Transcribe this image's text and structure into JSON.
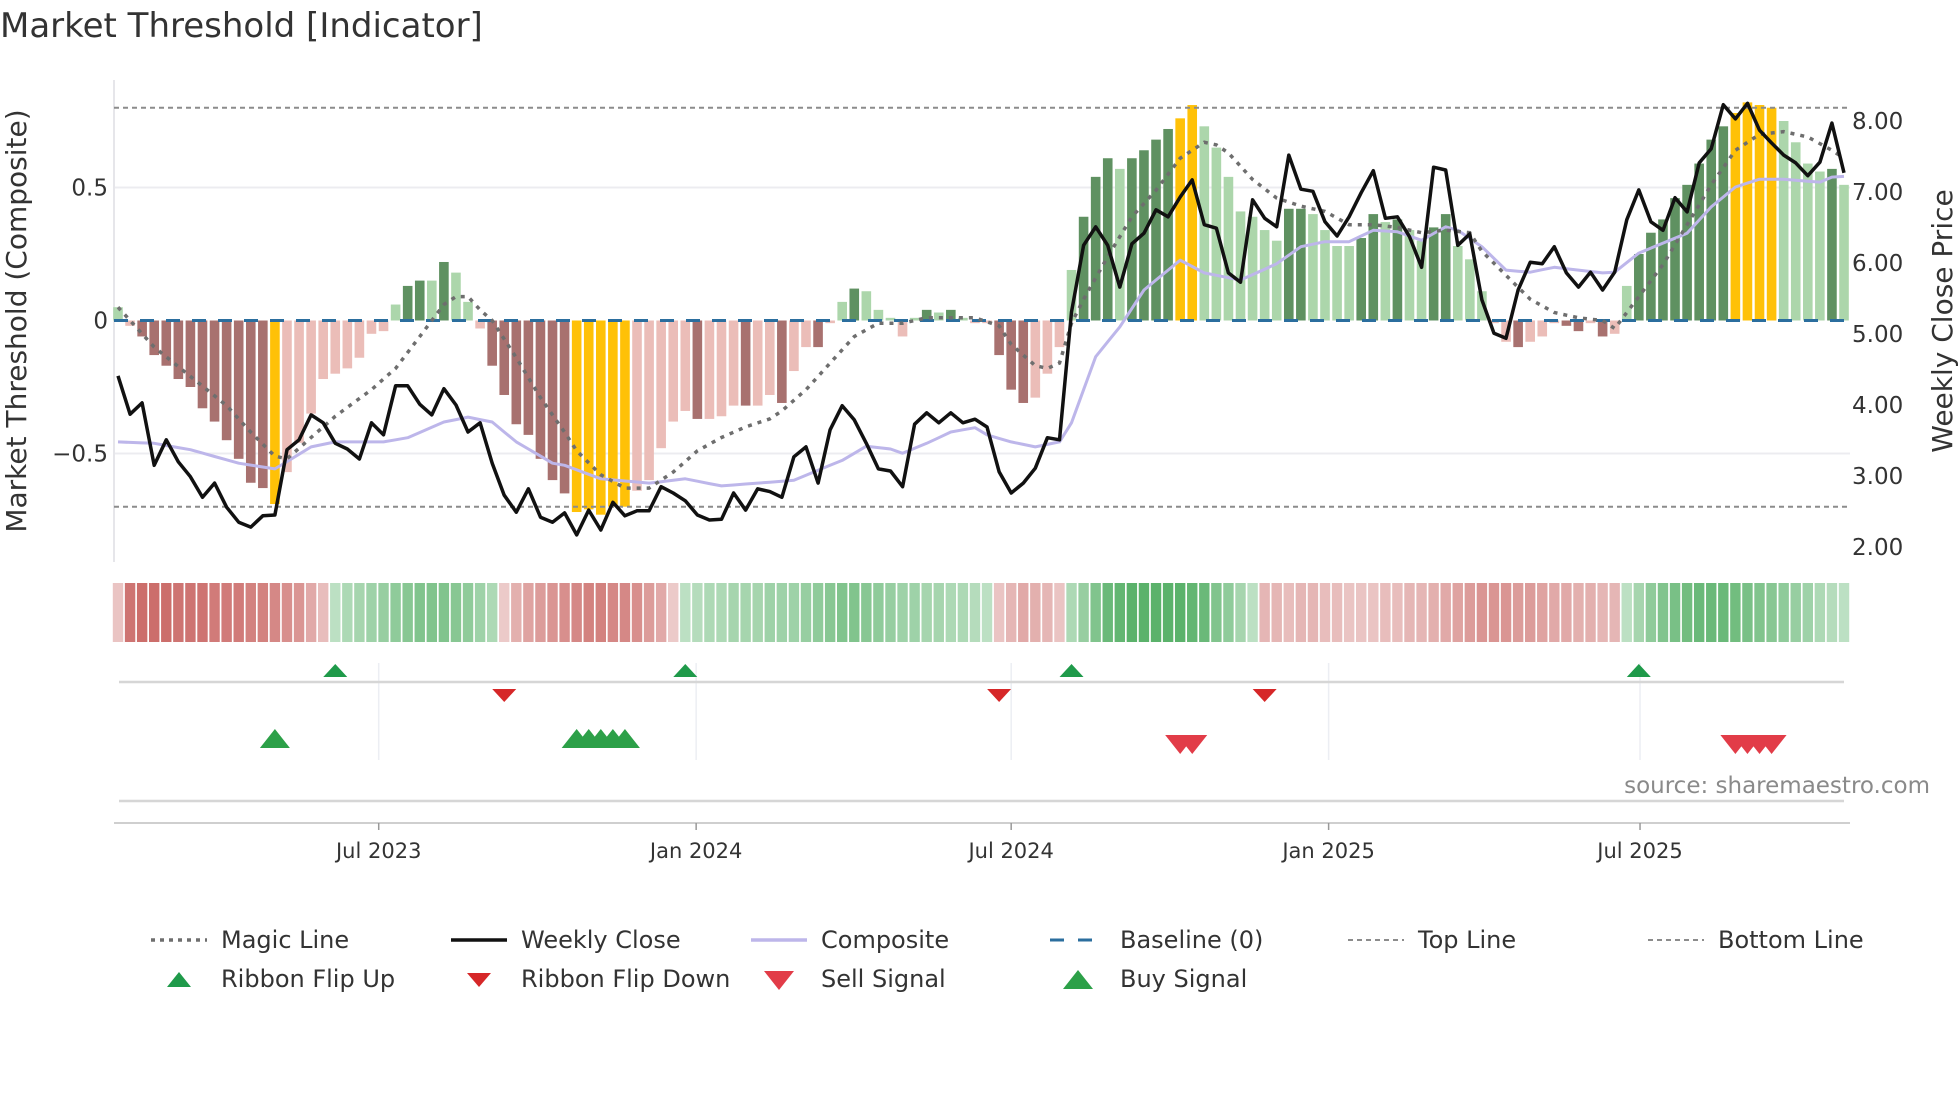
{
  "title": "Market Threshold [Indicator]",
  "source": "source: sharemaestro.com",
  "colors": {
    "dark_green": "#5f9161",
    "light_green": "#acd6ab",
    "dark_red": "#a8716f",
    "light_red": "#ebbdb8",
    "yellow": "#ffc107",
    "close": "#111111",
    "composite": "#bdb6ea",
    "magic": "#6e6e6e",
    "baseline": "#2b6e9e",
    "threshold": "#8c8c8c",
    "ribbon_red": "#c55a57",
    "ribbon_green": "#45a857",
    "flip_up": "#1f9a4a",
    "flip_down": "#d62728",
    "buy": "#2ca048",
    "sell": "#e23c48"
  },
  "legend": [
    {
      "key": "magic",
      "label": "Magic Line"
    },
    {
      "key": "close",
      "label": "Weekly Close"
    },
    {
      "key": "composite",
      "label": "Composite"
    },
    {
      "key": "baseline",
      "label": "Baseline (0)"
    },
    {
      "key": "top",
      "label": "Top Line"
    },
    {
      "key": "bottom",
      "label": "Bottom Line"
    },
    {
      "key": "flip_up",
      "label": "Ribbon Flip Up"
    },
    {
      "key": "flip_down",
      "label": "Ribbon Flip Down"
    },
    {
      "key": "sell",
      "label": "Sell Signal"
    },
    {
      "key": "buy",
      "label": "Buy Signal"
    }
  ],
  "chart_data": {
    "type": "bar+line",
    "title": "Market Threshold [Indicator]",
    "ylabel_left": "Market Threshold (Composite)",
    "ylabel_right": "Weekly Close Price",
    "x_unit": "week index (weekly, ~Feb 2023 to Oct 2025)",
    "x_ticks": [
      {
        "label": "Jul 2023",
        "week": 21.6
      },
      {
        "label": "Jan 2024",
        "week": 47.9
      },
      {
        "label": "Jul 2024",
        "week": 74.0
      },
      {
        "label": "Jan 2025",
        "week": 100.3
      },
      {
        "label": "Jul 2025",
        "week": 126.1
      }
    ],
    "left_axis": {
      "ylim": [
        -1.0,
        0.88
      ],
      "ticks": [
        {
          "v": 0.5,
          "label": "0.5"
        },
        {
          "v": 0,
          "label": "0"
        },
        {
          "v": -0.5,
          "label": "−0.5"
        }
      ]
    },
    "right_axis": {
      "ylim": [
        1.8,
        8.5
      ],
      "ticks": [
        {
          "v": 8,
          "label": "8.00"
        },
        {
          "v": 7,
          "label": "7.00"
        },
        {
          "v": 6,
          "label": "6.00"
        },
        {
          "v": 5,
          "label": "5.00"
        },
        {
          "v": 4,
          "label": "4.00"
        },
        {
          "v": 3,
          "label": "3.00"
        },
        {
          "v": 2,
          "label": "2.00"
        }
      ]
    },
    "top_line": 0.8,
    "bottom_line": -0.7,
    "baseline": 0,
    "histogram": [
      0.05,
      -0.02,
      -0.06,
      -0.13,
      -0.17,
      -0.22,
      -0.25,
      -0.33,
      -0.38,
      -0.45,
      -0.52,
      -0.61,
      -0.63,
      -0.69,
      -0.57,
      -0.46,
      -0.35,
      -0.22,
      -0.2,
      -0.18,
      -0.14,
      -0.05,
      -0.04,
      0.06,
      0.13,
      0.15,
      0.15,
      0.22,
      0.18,
      0.07,
      -0.03,
      -0.17,
      -0.28,
      -0.39,
      -0.43,
      -0.52,
      -0.6,
      -0.65,
      -0.72,
      -0.71,
      -0.73,
      -0.7,
      -0.7,
      -0.64,
      -0.6,
      -0.48,
      -0.38,
      -0.34,
      -0.37,
      -0.37,
      -0.36,
      -0.32,
      -0.32,
      -0.32,
      -0.28,
      -0.31,
      -0.19,
      -0.1,
      -0.1,
      -0.01,
      0.07,
      0.12,
      0.11,
      0.04,
      0.01,
      -0.06,
      0.01,
      0.04,
      0.03,
      0.04,
      0.01,
      -0.01,
      -0.01,
      -0.13,
      -0.26,
      -0.31,
      -0.29,
      -0.2,
      -0.1,
      0.19,
      0.39,
      0.54,
      0.61,
      0.57,
      0.61,
      0.64,
      0.68,
      0.72,
      0.76,
      0.81,
      0.73,
      0.65,
      0.54,
      0.41,
      0.39,
      0.34,
      0.3,
      0.42,
      0.42,
      0.4,
      0.34,
      0.28,
      0.28,
      0.31,
      0.4,
      0.37,
      0.38,
      0.34,
      0.3,
      0.35,
      0.4,
      0.28,
      0.23,
      0.11,
      -0.01,
      -0.08,
      -0.1,
      -0.08,
      -0.06,
      -0.01,
      -0.02,
      -0.04,
      -0.01,
      -0.06,
      -0.05,
      0.13,
      0.25,
      0.33,
      0.38,
      0.46,
      0.51,
      0.59,
      0.68,
      0.73,
      0.78,
      0.82,
      0.81,
      0.8,
      0.75,
      0.67,
      0.59,
      0.56,
      0.57,
      0.51
    ],
    "histogram_states": "grRRRRRRRRRRRYrrrrrrrrrgGGgGggrRRRRRRRYYYYYrrrrrRrrrRrrRrrRrgGgggrgGgGgrrRRRrrrgGGGgGGGGYYgggggggGGggggGGgGggGGgggrrRrrrRRrRrgGGGGGGGGYYYYggggGg",
    "histogram_state_legend": {
      "G": "strong up",
      "g": "weak up",
      "R": "strong down",
      "r": "weak down",
      "Y": "extreme"
    },
    "weekly_close": [
      4.41,
      3.87,
      4.03,
      3.15,
      3.51,
      3.2,
      2.99,
      2.7,
      2.9,
      2.56,
      2.35,
      2.28,
      2.44,
      2.45,
      3.37,
      3.51,
      3.86,
      3.75,
      3.46,
      3.38,
      3.24,
      3.75,
      3.58,
      4.27,
      4.27,
      4.01,
      3.86,
      4.23,
      4.0,
      3.62,
      3.75,
      3.18,
      2.73,
      2.49,
      2.82,
      2.42,
      2.35,
      2.48,
      2.17,
      2.52,
      2.24,
      2.63,
      2.44,
      2.51,
      2.51,
      2.85,
      2.76,
      2.65,
      2.45,
      2.38,
      2.39,
      2.76,
      2.52,
      2.82,
      2.78,
      2.7,
      3.27,
      3.41,
      2.9,
      3.65,
      3.99,
      3.79,
      3.46,
      3.1,
      3.07,
      2.85,
      3.73,
      3.89,
      3.75,
      3.89,
      3.75,
      3.8,
      3.69,
      3.06,
      2.76,
      2.9,
      3.11,
      3.54,
      3.51,
      5.31,
      6.25,
      6.51,
      6.25,
      5.66,
      6.27,
      6.42,
      6.75,
      6.65,
      6.93,
      7.17,
      6.54,
      6.49,
      5.86,
      5.73,
      6.89,
      6.63,
      6.51,
      7.52,
      7.04,
      7.01,
      6.58,
      6.38,
      6.65,
      6.99,
      7.3,
      6.63,
      6.65,
      6.37,
      5.94,
      7.35,
      7.31,
      6.25,
      6.41,
      5.48,
      5.01,
      4.94,
      5.62,
      6.01,
      5.99,
      6.23,
      5.86,
      5.66,
      5.87,
      5.62,
      5.87,
      6.61,
      7.03,
      6.58,
      6.46,
      6.92,
      6.72,
      7.41,
      7.61,
      8.23,
      8.03,
      8.25,
      7.87,
      7.69,
      7.52,
      7.41,
      7.23,
      7.42,
      7.97,
      7.27
    ],
    "composite": [
      [
        0,
        3.48
      ],
      [
        3,
        3.46
      ],
      [
        6,
        3.37
      ],
      [
        10,
        3.18
      ],
      [
        13,
        3.1
      ],
      [
        16,
        3.41
      ],
      [
        18,
        3.48
      ],
      [
        22,
        3.48
      ],
      [
        24,
        3.54
      ],
      [
        27,
        3.76
      ],
      [
        29,
        3.83
      ],
      [
        31,
        3.76
      ],
      [
        33,
        3.48
      ],
      [
        36,
        3.18
      ],
      [
        37,
        3.15
      ],
      [
        40,
        2.96
      ],
      [
        44,
        2.9
      ],
      [
        47,
        2.96
      ],
      [
        50,
        2.86
      ],
      [
        53,
        2.9
      ],
      [
        56,
        2.94
      ],
      [
        58,
        3.08
      ],
      [
        60,
        3.22
      ],
      [
        62,
        3.42
      ],
      [
        64,
        3.38
      ],
      [
        65,
        3.32
      ],
      [
        67,
        3.46
      ],
      [
        69,
        3.62
      ],
      [
        71,
        3.68
      ],
      [
        72,
        3.58
      ],
      [
        74,
        3.48
      ],
      [
        76,
        3.41
      ],
      [
        78,
        3.48
      ],
      [
        79,
        3.75
      ],
      [
        81,
        4.68
      ],
      [
        83,
        5.1
      ],
      [
        85,
        5.62
      ],
      [
        88,
        6.04
      ],
      [
        90,
        5.86
      ],
      [
        93,
        5.76
      ],
      [
        96,
        5.99
      ],
      [
        98,
        6.23
      ],
      [
        100,
        6.3
      ],
      [
        102,
        6.3
      ],
      [
        104,
        6.46
      ],
      [
        106,
        6.44
      ],
      [
        108,
        6.32
      ],
      [
        110,
        6.51
      ],
      [
        111,
        6.46
      ],
      [
        113,
        6.23
      ],
      [
        115,
        5.9
      ],
      [
        117,
        5.87
      ],
      [
        119,
        5.94
      ],
      [
        121,
        5.9
      ],
      [
        123,
        5.86
      ],
      [
        124,
        5.87
      ],
      [
        126,
        6.14
      ],
      [
        128,
        6.28
      ],
      [
        130,
        6.42
      ],
      [
        132,
        6.79
      ],
      [
        134,
        7.07
      ],
      [
        136,
        7.18
      ],
      [
        138,
        7.18
      ],
      [
        140,
        7.15
      ],
      [
        141,
        7.14
      ],
      [
        142,
        7.21
      ],
      [
        143,
        7.22
      ]
    ],
    "magic_line": [
      [
        0,
        0.05
      ],
      [
        3,
        -0.1
      ],
      [
        6,
        -0.21
      ],
      [
        9,
        -0.32
      ],
      [
        11,
        -0.42
      ],
      [
        13,
        -0.51
      ],
      [
        14,
        -0.52
      ],
      [
        16,
        -0.44
      ],
      [
        18,
        -0.36
      ],
      [
        21,
        -0.26
      ],
      [
        23,
        -0.18
      ],
      [
        25,
        -0.06
      ],
      [
        27,
        0.06
      ],
      [
        28,
        0.09
      ],
      [
        29,
        0.09
      ],
      [
        30,
        0.04
      ],
      [
        31,
        0.0
      ],
      [
        33,
        -0.14
      ],
      [
        35,
        -0.29
      ],
      [
        37,
        -0.42
      ],
      [
        38,
        -0.49
      ],
      [
        40,
        -0.58
      ],
      [
        42,
        -0.63
      ],
      [
        44,
        -0.63
      ],
      [
        46,
        -0.57
      ],
      [
        48,
        -0.49
      ],
      [
        50,
        -0.44
      ],
      [
        52,
        -0.4
      ],
      [
        54,
        -0.37
      ],
      [
        55,
        -0.34
      ],
      [
        57,
        -0.26
      ],
      [
        59,
        -0.16
      ],
      [
        61,
        -0.06
      ],
      [
        63,
        -0.01
      ],
      [
        65,
        -0.01
      ],
      [
        67,
        0.01
      ],
      [
        69,
        0.01
      ],
      [
        71,
        0.01
      ],
      [
        73,
        -0.02
      ],
      [
        74,
        -0.09
      ],
      [
        75,
        -0.13
      ],
      [
        76,
        -0.17
      ],
      [
        77,
        -0.18
      ],
      [
        78,
        -0.16
      ],
      [
        79,
        -0.01
      ],
      [
        80,
        0.08
      ],
      [
        82,
        0.24
      ],
      [
        84,
        0.39
      ],
      [
        86,
        0.49
      ],
      [
        88,
        0.61
      ],
      [
        90,
        0.67
      ],
      [
        91,
        0.66
      ],
      [
        92,
        0.63
      ],
      [
        94,
        0.53
      ],
      [
        96,
        0.46
      ],
      [
        98,
        0.43
      ],
      [
        100,
        0.41
      ],
      [
        102,
        0.36
      ],
      [
        104,
        0.36
      ],
      [
        106,
        0.35
      ],
      [
        108,
        0.33
      ],
      [
        110,
        0.34
      ],
      [
        112,
        0.33
      ],
      [
        113,
        0.26
      ],
      [
        115,
        0.17
      ],
      [
        117,
        0.08
      ],
      [
        119,
        0.03
      ],
      [
        121,
        0.01
      ],
      [
        123,
        0.0
      ],
      [
        124,
        -0.03
      ],
      [
        125,
        0.03
      ],
      [
        126,
        0.09
      ],
      [
        128,
        0.21
      ],
      [
        130,
        0.36
      ],
      [
        132,
        0.51
      ],
      [
        134,
        0.64
      ],
      [
        136,
        0.7
      ],
      [
        138,
        0.71
      ],
      [
        140,
        0.69
      ],
      [
        142,
        0.64
      ],
      [
        143,
        0.61
      ]
    ],
    "ribbon": [
      -0.2,
      -0.8,
      -0.85,
      -0.85,
      -0.85,
      -0.8,
      -0.8,
      -0.8,
      -0.75,
      -0.75,
      -0.75,
      -0.7,
      -0.7,
      -0.65,
      -0.6,
      -0.55,
      -0.4,
      -0.25,
      0.2,
      0.3,
      0.35,
      0.4,
      0.45,
      0.5,
      0.55,
      0.6,
      0.6,
      0.6,
      0.55,
      0.5,
      0.4,
      0.3,
      -0.15,
      -0.35,
      -0.45,
      -0.5,
      -0.55,
      -0.6,
      -0.65,
      -0.7,
      -0.7,
      -0.65,
      -0.65,
      -0.6,
      -0.5,
      -0.4,
      -0.15,
      0.2,
      0.25,
      0.3,
      0.3,
      0.35,
      0.35,
      0.35,
      0.4,
      0.4,
      0.4,
      0.45,
      0.5,
      0.55,
      0.6,
      0.6,
      0.55,
      0.5,
      0.45,
      0.4,
      0.4,
      0.35,
      0.35,
      0.3,
      0.3,
      0.25,
      0.2,
      -0.2,
      -0.3,
      -0.4,
      -0.35,
      -0.3,
      -0.2,
      0.3,
      0.45,
      0.6,
      0.75,
      0.8,
      0.85,
      0.85,
      0.85,
      0.85,
      0.85,
      0.8,
      0.75,
      0.6,
      0.5,
      0.35,
      0.2,
      -0.3,
      -0.3,
      -0.25,
      -0.3,
      -0.3,
      -0.25,
      -0.25,
      -0.2,
      -0.2,
      -0.2,
      -0.25,
      -0.25,
      -0.3,
      -0.3,
      -0.35,
      -0.4,
      -0.45,
      -0.5,
      -0.55,
      -0.55,
      -0.55,
      -0.5,
      -0.5,
      -0.45,
      -0.4,
      -0.4,
      -0.35,
      -0.35,
      -0.3,
      -0.3,
      0.2,
      0.35,
      0.5,
      0.6,
      0.65,
      0.7,
      0.75,
      0.75,
      0.75,
      0.7,
      0.65,
      0.6,
      0.55,
      0.5,
      0.45,
      0.4,
      0.3,
      0.25,
      0.2
    ],
    "ribbon_flip_up_weeks": [
      18,
      47,
      79,
      126
    ],
    "ribbon_flip_down_weeks": [
      32,
      73,
      95
    ],
    "buy_signal_weeks": [
      13,
      38,
      39,
      40,
      41,
      42
    ],
    "sell_signal_weeks": [
      88,
      89,
      134,
      135,
      136,
      137
    ]
  }
}
